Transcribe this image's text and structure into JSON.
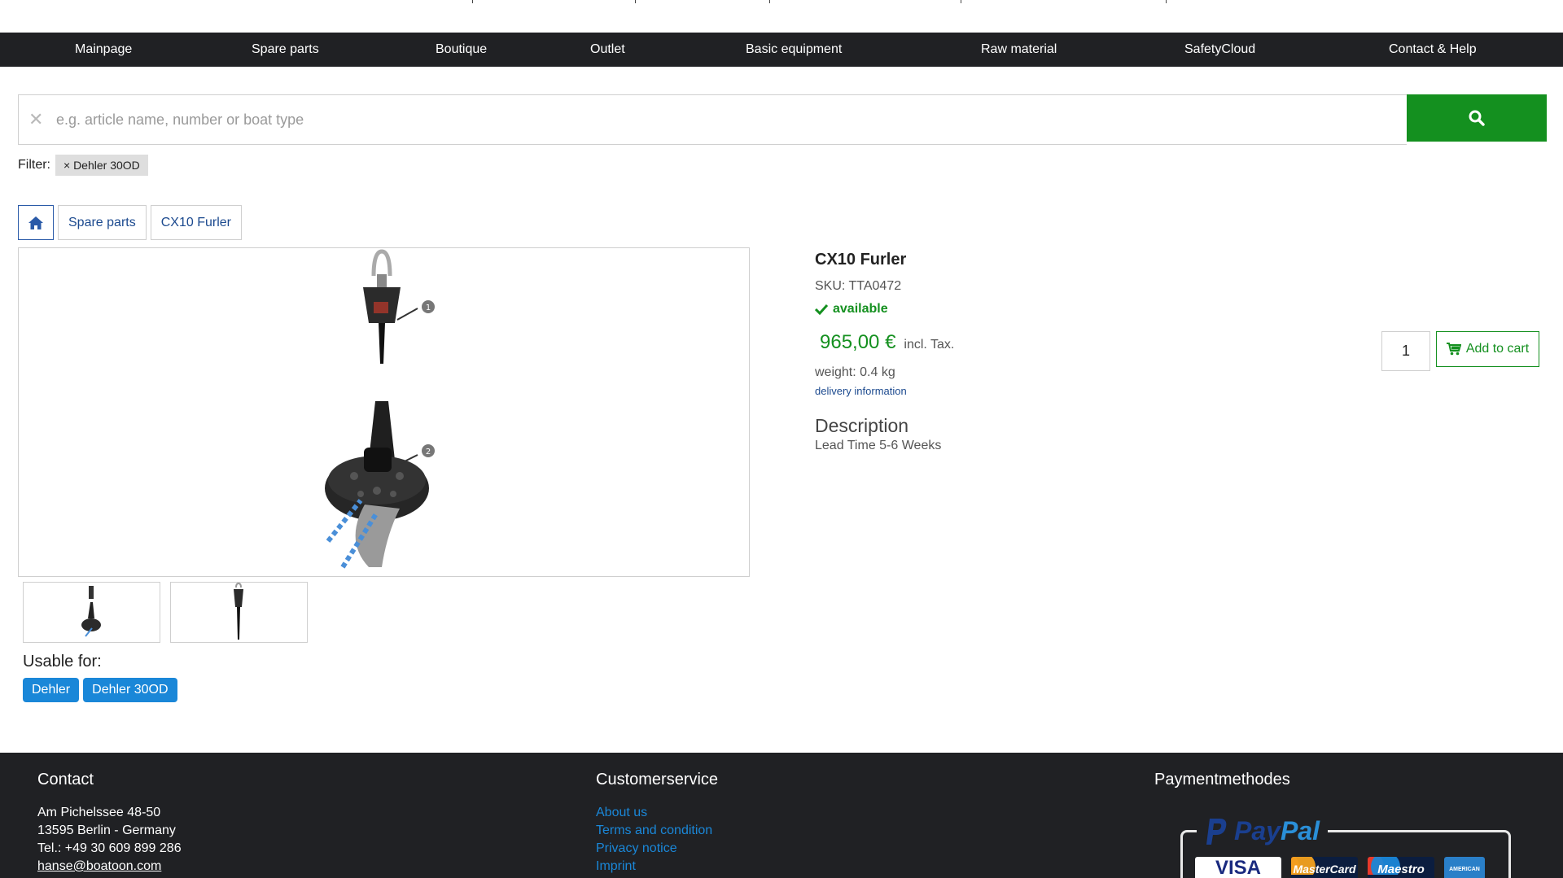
{
  "nav": {
    "items": [
      "Mainpage",
      "Spare parts",
      "Boutique",
      "Outlet",
      "Basic equipment",
      "Raw material",
      "SafetyCloud",
      "Contact & Help"
    ]
  },
  "search": {
    "placeholder": "e.g. article name, number or boat type",
    "clear_icon": "close-icon",
    "button_icon": "search-icon"
  },
  "filter": {
    "label": "Filter:",
    "chip": "× Dehler 30OD"
  },
  "breadcrumb": {
    "home_icon": "home-icon",
    "items": [
      "Spare parts",
      "CX10 Furler"
    ]
  },
  "gallery": {
    "callouts": [
      "1",
      "2"
    ],
    "thumbnail_count": 2
  },
  "usable": {
    "label": "Usable for:",
    "tags": [
      "Dehler",
      "Dehler 30OD"
    ]
  },
  "product": {
    "title": "CX10 Furler",
    "sku": "SKU: TTA0472",
    "availability": "available",
    "price": "965,00 €",
    "tax": "incl. Tax.",
    "weight": "weight: 0.4 kg",
    "delivery": "delivery information",
    "description_heading": "Description",
    "description_text": "Lead Time 5-6 Weeks",
    "quantity": "1",
    "add_to_cart": "Add to cart"
  },
  "footer": {
    "contact": {
      "heading": "Contact",
      "address1": "Am Pichelssee 48-50",
      "address2": "13595 Berlin - Germany",
      "phone": "Tel.: +49 30 609 899 286",
      "email": "hanse@boatoon.com"
    },
    "service": {
      "heading": "Customerservice",
      "links": [
        "About us",
        "Terms and condition",
        "Privacy notice",
        "Imprint"
      ]
    },
    "payment": {
      "heading": "Paymentmethodes",
      "paypal_a": "Pay",
      "paypal_b": "Pal",
      "cards": [
        "VISA",
        "MasterCard",
        "Maestro",
        "AMERICAN"
      ]
    }
  },
  "colors": {
    "nav_bg": "#202124",
    "accent_green": "#14901f",
    "link_blue": "#1a87d8",
    "crumb_blue": "#1c4a8f"
  }
}
